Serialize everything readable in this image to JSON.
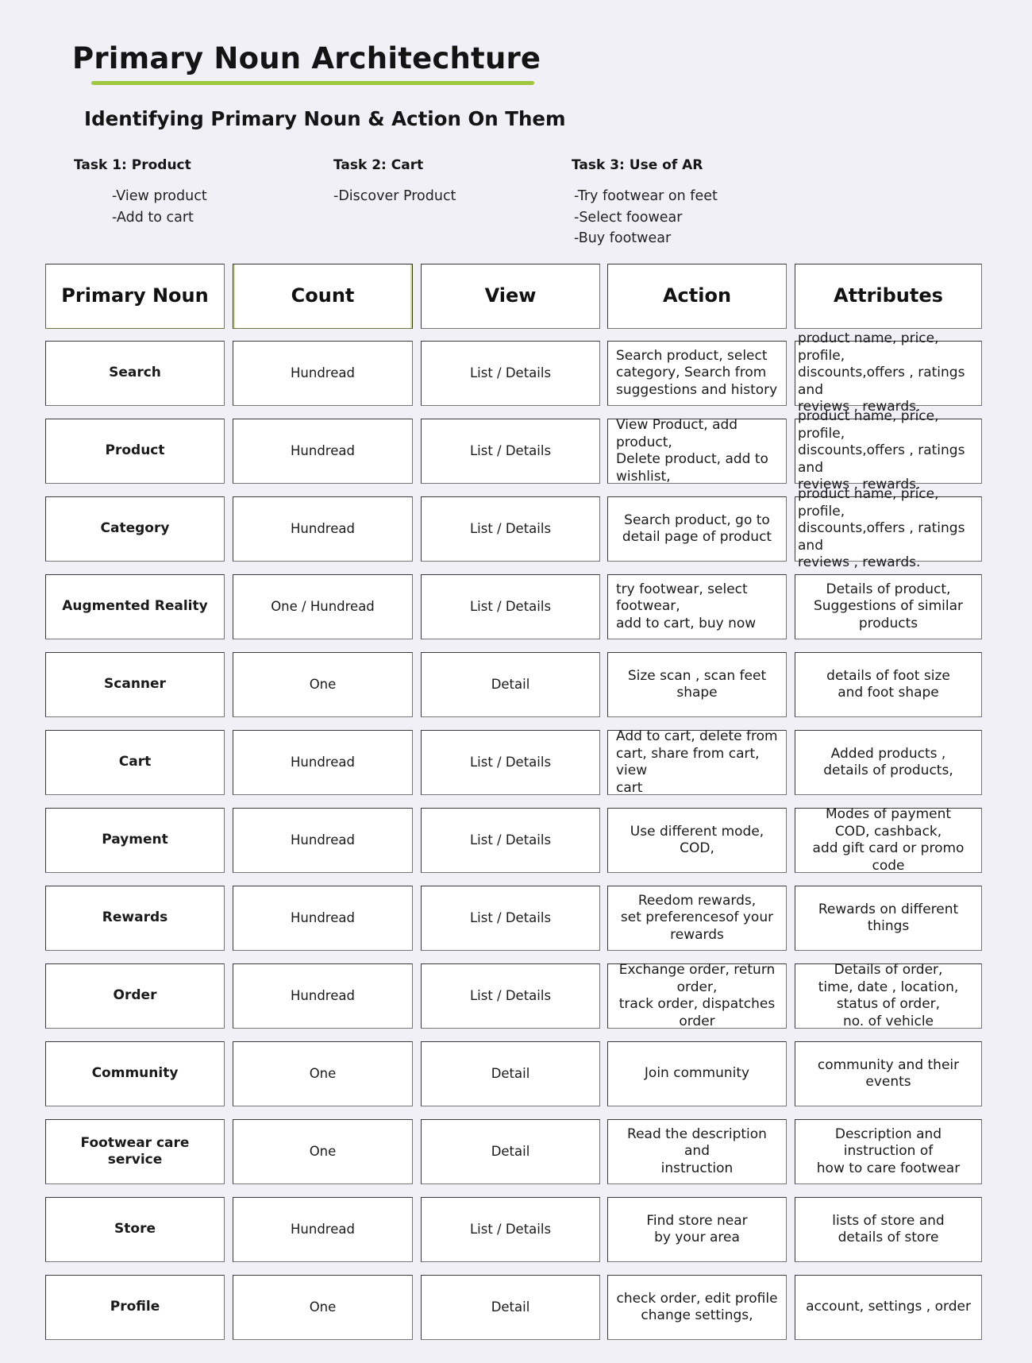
{
  "header": {
    "title": "Primary Noun Architechture",
    "accent_color": "#9fc740",
    "subtitle": "Identifying Primary Noun & Action On Them"
  },
  "tasks": [
    {
      "heading": "Task 1: Product",
      "items": [
        "-View product",
        "-Add to cart"
      ]
    },
    {
      "heading": "Task 2: Cart",
      "items": [
        "-Discover Product"
      ]
    },
    {
      "heading": "Task 3: Use of AR",
      "items": [
        "-Try footwear on feet",
        "-Select foowear",
        "-Buy footwear"
      ]
    }
  ],
  "table": {
    "columns": [
      "Primary Noun",
      "Count",
      "View",
      "Action",
      "Attributes"
    ],
    "rows": [
      {
        "noun": "Search",
        "count": "Hundread",
        "view": "List / Details",
        "action": "Search product, select\ncategory, Search from\nsuggestions and history",
        "attributes": "product name, price, profile,\ndiscounts,offers , ratings and\nreviews , rewards."
      },
      {
        "noun": "Product",
        "count": "Hundread",
        "view": "List / Details",
        "action": "View Product, add product,\nDelete product, add to\nwishlist,",
        "attributes": "product name, price, profile,\ndiscounts,offers , ratings and\nreviews , rewards."
      },
      {
        "noun": "Category",
        "count": "Hundread",
        "view": "List / Details",
        "action": "Search product, go to\ndetail page of product",
        "attributes": "product name, price, profile,\ndiscounts,offers , ratings and\nreviews , rewards."
      },
      {
        "noun": "Augmented Reality",
        "count": "One / Hundread",
        "view": "List / Details",
        "action": "try footwear, select footwear,\nadd to cart, buy now",
        "attributes": "Details of product,\nSuggestions of similar\nproducts"
      },
      {
        "noun": "Scanner",
        "count": "One",
        "view": "Detail",
        "action": "Size scan , scan feet shape",
        "attributes": "details of foot size\nand foot shape"
      },
      {
        "noun": "Cart",
        "count": "Hundread",
        "view": "List / Details",
        "action": "Add to cart, delete from\ncart, share from cart, view\ncart",
        "attributes": "Added products ,\ndetails of products,"
      },
      {
        "noun": "Payment",
        "count": "Hundread",
        "view": "List / Details",
        "action": "Use different mode, COD,",
        "attributes": "Modes of payment\nCOD, cashback,\nadd gift card or promo code"
      },
      {
        "noun": "Rewards",
        "count": "Hundread",
        "view": "List / Details",
        "action": "Reedom rewards,\nset preferencesof your\nrewards",
        "attributes": "Rewards on different\nthings"
      },
      {
        "noun": "Order",
        "count": "Hundread",
        "view": "List / Details",
        "action": "Exchange order, return order,\ntrack order, dispatches order",
        "attributes": "Details of order,\ntime, date , location,\nstatus of order,\nno. of vehicle"
      },
      {
        "noun": "Community",
        "count": "One",
        "view": "Detail",
        "action": "Join community",
        "attributes": "community and their\nevents"
      },
      {
        "noun": "Footwear care\nservice",
        "count": "One",
        "view": "Detail",
        "action": "Read the description and\ninstruction",
        "attributes": "Description and\ninstruction of\nhow to care footwear"
      },
      {
        "noun": "Store",
        "count": "Hundread",
        "view": "List / Details",
        "action": "Find store near\nby your area",
        "attributes": "lists of store and\ndetails of store"
      },
      {
        "noun": "Profile",
        "count": "One",
        "view": "Detail",
        "action": "check order, edit profile\nchange settings,",
        "attributes": "account, settings , order"
      }
    ]
  }
}
